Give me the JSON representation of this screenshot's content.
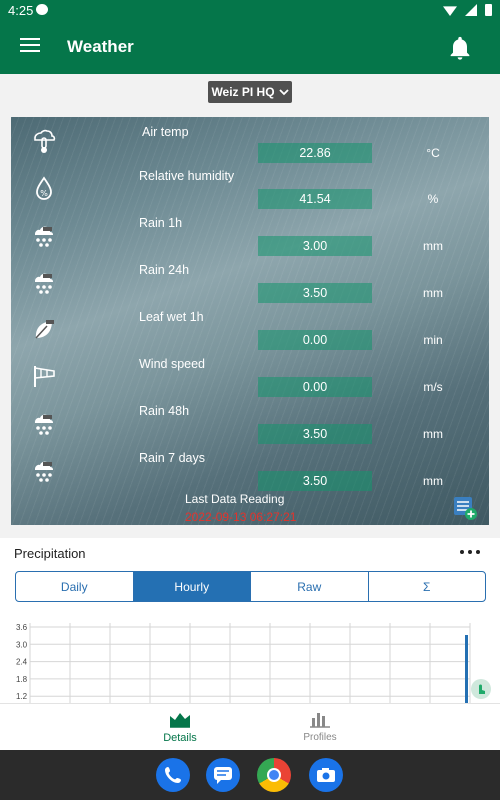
{
  "status": {
    "time": "4:25"
  },
  "app": {
    "title": "Weather"
  },
  "selector": {
    "value": "Weiz PI HQ"
  },
  "sensors": [
    {
      "label": "Air temp",
      "value": "22.86",
      "unit": "°C",
      "icon": "thermometer-icon"
    },
    {
      "label": "Relative humidity",
      "value": "41.54",
      "unit": "%",
      "icon": "humidity-icon"
    },
    {
      "label": "Rain 1h",
      "value": "3.00",
      "unit": "mm",
      "icon": "rain-cloud-icon"
    },
    {
      "label": "Rain 24h",
      "value": "3.50",
      "unit": "mm",
      "icon": "rain-cloud-icon"
    },
    {
      "label": "Leaf wet 1h",
      "value": "0.00",
      "unit": "min",
      "icon": "leaf-icon"
    },
    {
      "label": "Wind speed",
      "value": "0.00",
      "unit": "m/s",
      "icon": "windsock-icon"
    },
    {
      "label": "Rain 48h",
      "value": "3.50",
      "unit": "mm",
      "icon": "rain-cloud-icon"
    },
    {
      "label": "Rain 7 days",
      "value": "3.50",
      "unit": "mm",
      "icon": "rain-cloud-icon"
    }
  ],
  "last_reading": {
    "label": "Last Data Reading",
    "time": "2022-09-13 06:27:21"
  },
  "precipitation": {
    "title": "Precipitation",
    "tabs": [
      "Daily",
      "Hourly",
      "Raw",
      "Σ"
    ],
    "active_tab": "Hourly"
  },
  "chart_data": {
    "type": "bar",
    "y_ticks": [
      "3.6",
      "3.0",
      "2.4",
      "1.8",
      "1.2"
    ],
    "series": [
      {
        "values": [
          3.6
        ]
      }
    ]
  },
  "nav": {
    "details": "Details",
    "profiles": "Profiles"
  },
  "colors": {
    "primary": "#05764a",
    "accent": "#2470b3",
    "alert": "#e5322b"
  }
}
